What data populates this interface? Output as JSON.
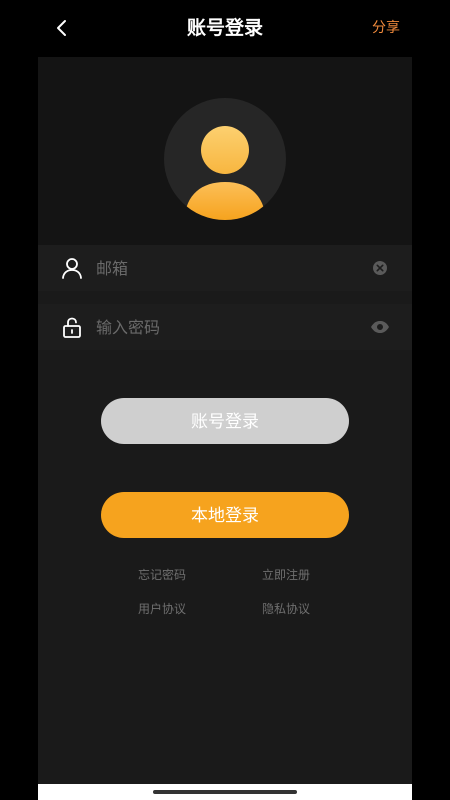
{
  "navbar": {
    "title": "账号登录",
    "share_label": "分享",
    "back_icon": "chevron-left-icon"
  },
  "avatar": {
    "icon": "user-avatar-icon",
    "colors": {
      "top": "#fcc65e",
      "bottom": "#f6a31e",
      "background": "#262626"
    }
  },
  "form": {
    "email": {
      "icon": "user-icon",
      "placeholder": "邮箱",
      "value": "",
      "action_icon": "clear-icon"
    },
    "password": {
      "icon": "unlock-icon",
      "placeholder": "输入密码",
      "value": "",
      "action_icon": "eye-icon"
    }
  },
  "buttons": {
    "account_login": "账号登录",
    "local_login": "本地登录"
  },
  "links": {
    "forgot_password": "忘记密码",
    "register": "立即注册",
    "user_agreement": "用户协议",
    "privacy_policy": "隐私协议"
  },
  "colors": {
    "accent": "#f6a31e",
    "share": "#f08a3c",
    "disabled_button": "#cfcfcf"
  }
}
